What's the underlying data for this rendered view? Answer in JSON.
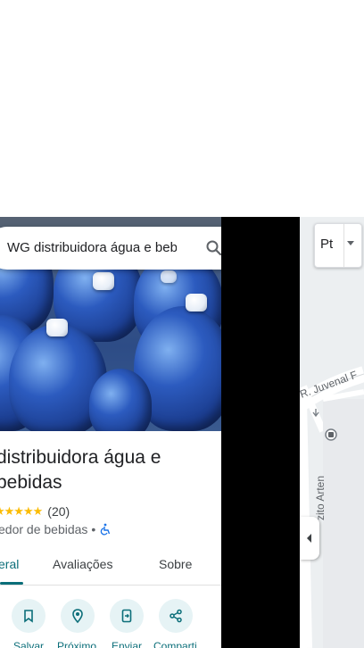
{
  "search": {
    "query": "WG distribuidora água e bebidas"
  },
  "place": {
    "title": "distribuidora água e bebidas",
    "rating": "4,5",
    "stars": "★★★★★",
    "review_count": "(20)",
    "category": "edor de bebidas",
    "separator": "•"
  },
  "tabs": [
    {
      "label": "eral",
      "active": true
    },
    {
      "label": "Avaliações",
      "active": false
    },
    {
      "label": "Sobre",
      "active": false
    }
  ],
  "actions": [
    {
      "label": "Salvar",
      "icon": "bookmark-icon"
    },
    {
      "label": "Próximo",
      "icon": "nearby-icon"
    },
    {
      "label": "Enviar",
      "icon": "send-to-phone-icon"
    },
    {
      "label": "Comparti",
      "icon": "share-icon"
    }
  ],
  "map": {
    "language_label": "Pt",
    "street_1": "R. Juvenal F",
    "street_2": "zito Arten"
  },
  "colors": {
    "accent": "#0b6e79",
    "action_bg": "#e6f3f5",
    "star": "#fbbc04",
    "map_bg": "#eceff1"
  }
}
